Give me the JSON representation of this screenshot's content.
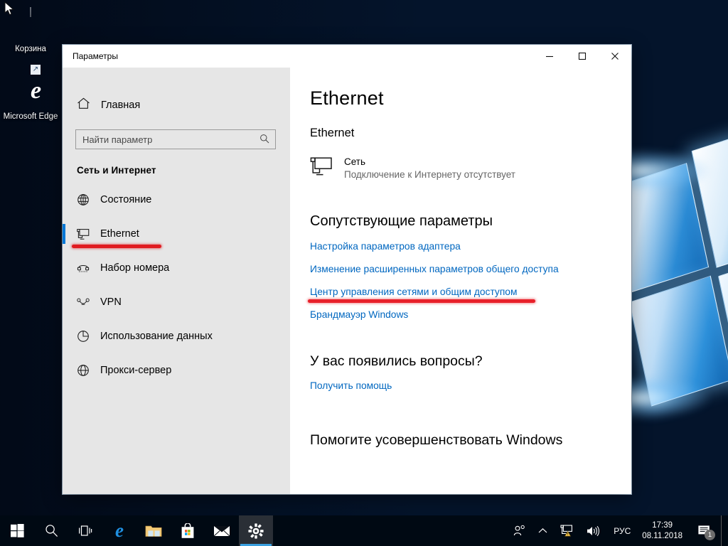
{
  "desktop": {
    "icons": [
      {
        "name": "Корзина",
        "icon": "recycle-bin-icon"
      },
      {
        "name": "Microsoft\nEdge",
        "label_line1": "Microsoft",
        "label_line2": "Edge",
        "icon": "edge-icon"
      }
    ]
  },
  "window": {
    "title": "Параметры",
    "buttons": {
      "minimize": "minimize-icon",
      "maximize": "maximize-icon",
      "close": "close-icon"
    }
  },
  "sidebar": {
    "home_label": "Главная",
    "home_icon": "home-icon",
    "search": {
      "placeholder": "Найти параметр",
      "value": "",
      "icon": "search-icon"
    },
    "category": "Сеть и Интернет",
    "items": [
      {
        "label": "Состояние",
        "icon": "globe-status-icon",
        "selected": false
      },
      {
        "label": "Ethernet",
        "icon": "ethernet-icon",
        "selected": true,
        "annotated": true
      },
      {
        "label": "Набор номера",
        "icon": "dialup-icon",
        "selected": false
      },
      {
        "label": "VPN",
        "icon": "vpn-icon",
        "selected": false
      },
      {
        "label": "Использование данных",
        "icon": "data-usage-icon",
        "selected": false
      },
      {
        "label": "Прокси-сервер",
        "icon": "proxy-globe-icon",
        "selected": false
      }
    ]
  },
  "content": {
    "page_title": "Ethernet",
    "section_title": "Ethernet",
    "network": {
      "icon": "network-pc-icon",
      "name": "Сеть",
      "status": "Подключение к Интернету отсутствует"
    },
    "related_title": "Сопутствующие параметры",
    "related_links": [
      {
        "label": "Настройка параметров адаптера",
        "annotated": false
      },
      {
        "label": "Изменение расширенных параметров общего доступа",
        "annotated": false
      },
      {
        "label": "Центр управления сетями и общим доступом",
        "annotated": true
      },
      {
        "label": "Брандмауэр Windows",
        "annotated": false
      }
    ],
    "questions_title": "У вас появились вопросы?",
    "help_link": "Получить помощь",
    "improve_title": "Помогите усовершенствовать Windows"
  },
  "taskbar": {
    "buttons": [
      {
        "name": "start-button",
        "icon": "windows-logo-icon"
      },
      {
        "name": "search-button",
        "icon": "search-icon"
      },
      {
        "name": "task-view-button",
        "icon": "task-view-icon"
      },
      {
        "name": "edge-taskbar-button",
        "icon": "edge-icon"
      },
      {
        "name": "file-explorer-button",
        "icon": "folder-icon"
      },
      {
        "name": "microsoft-store-button",
        "icon": "store-bag-icon"
      },
      {
        "name": "mail-button",
        "icon": "mail-envelope-icon"
      },
      {
        "name": "settings-button",
        "icon": "gear-icon",
        "active": true
      }
    ],
    "tray": {
      "people_icon": "people-icon",
      "chevron_icon": "chevron-up-icon",
      "network_icon": "network-warning-icon",
      "volume_icon": "speaker-icon",
      "language": "РУС",
      "time": "17:39",
      "date": "08.11.2018",
      "notifications_icon": "action-center-icon",
      "notifications_count": "1"
    }
  },
  "colors": {
    "accent": "#0078d7",
    "link": "#0067c0",
    "annotation_red": "#e01b20",
    "taskbar": "#000913",
    "sidebar": "#e6e6e6"
  }
}
